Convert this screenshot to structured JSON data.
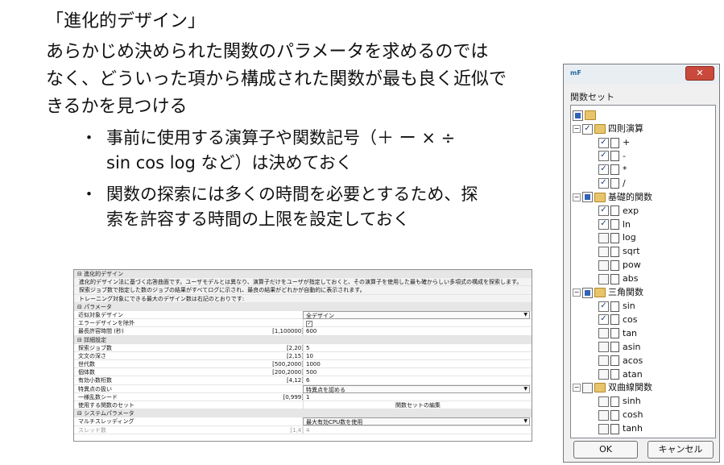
{
  "slide": {
    "title": "「進化的デザイン」",
    "paragraph": [
      "あらかじめ決められた関数のパラメータを求めるのでは",
      "なく、どういった項から構成された関数が最も良く近似で",
      "きるかを見つける"
    ],
    "bullets": [
      {
        "dot": "・",
        "lines": [
          "事前に使用する演算子や関数記号（＋ ー × ÷",
          "sin cos log など）は決めておく"
        ]
      },
      {
        "dot": "・",
        "lines": [
          "関数の探索には多くの時間を必要とするため、探",
          "索を許容する時間の上限を設定しておく"
        ]
      }
    ]
  },
  "panel": {
    "sec1": "⊟ 進化的デザイン",
    "desc": [
      "進化的デザイン法に基づく応答曲面です。ユーザモデルとは異なり、演算子だけをユーザが指定しておくと、その演算子を使用した最も確からしい多項式の構成を探索します。",
      "探索ジョブ数で指定した数のジョブの結果がすべてログに示され、最良の結果がどれかが自動的に表示されます。",
      "トレーニング対象にできる最大のデザイン数は右記のとおりです:"
    ],
    "sec2": "⊟ パラメータ",
    "params": [
      {
        "label": "近似対象デザイン",
        "range": "",
        "value": "全デザイン",
        "type": "dropdown"
      },
      {
        "label": "エラーデザインを除外",
        "range": "",
        "value": "✓",
        "type": "check"
      },
      {
        "label": "最長許容時間 (秒)",
        "range": "[1,100000]",
        "value": "600",
        "type": "text"
      }
    ],
    "sec3": "⊟ 詳細設定",
    "adv": [
      {
        "label": "探索ジョブ数",
        "range": "[2,20]",
        "value": "5",
        "type": "text"
      },
      {
        "label": "文文の深さ",
        "range": "[2,15]",
        "value": "10",
        "type": "text"
      },
      {
        "label": "世代数",
        "range": "[500,2000]",
        "value": "1000",
        "type": "text"
      },
      {
        "label": "個体数",
        "range": "[200,2000]",
        "value": "500",
        "type": "text"
      },
      {
        "label": "有効小数桁数",
        "range": "[4,12]",
        "value": "6",
        "type": "text"
      },
      {
        "label": "特異点の扱い",
        "range": "",
        "value": "特異点を認める",
        "type": "dropdown"
      },
      {
        "label": "一様乱数シード",
        "range": "[0,999]",
        "value": "1",
        "type": "text"
      },
      {
        "label": "使用する関数のセット",
        "range": "",
        "value": "関数セットの編集",
        "type": "button"
      }
    ],
    "sec4": "⊟ システムパラメータ",
    "sys": [
      {
        "label": "マルチスレッディング",
        "range": "",
        "value": "最大有効CPU数を使用",
        "type": "dropdown"
      },
      {
        "label": "スレッド数",
        "range": "[1,4]",
        "value": "4",
        "type": "text",
        "disabled": true
      }
    ]
  },
  "dialog": {
    "app_icon": "mF",
    "close": "✕",
    "label": "関数セット",
    "root_check": "ind",
    "groups": [
      {
        "name": "四則演算",
        "check": "on",
        "items": [
          {
            "name": "+",
            "check": "on"
          },
          {
            "name": "-",
            "check": "on"
          },
          {
            "name": "*",
            "check": "on"
          },
          {
            "name": "/",
            "check": "on"
          }
        ]
      },
      {
        "name": "基礎的関数",
        "check": "ind",
        "items": [
          {
            "name": "exp",
            "check": "on"
          },
          {
            "name": "ln",
            "check": "on"
          },
          {
            "name": "log",
            "check": "off"
          },
          {
            "name": "sqrt",
            "check": "off"
          },
          {
            "name": "pow",
            "check": "off"
          },
          {
            "name": "abs",
            "check": "off"
          }
        ]
      },
      {
        "name": "三角関数",
        "check": "ind",
        "items": [
          {
            "name": "sin",
            "check": "on"
          },
          {
            "name": "cos",
            "check": "on"
          },
          {
            "name": "tan",
            "check": "off"
          },
          {
            "name": "asin",
            "check": "off"
          },
          {
            "name": "acos",
            "check": "off"
          },
          {
            "name": "atan",
            "check": "off"
          }
        ]
      },
      {
        "name": "双曲線関数",
        "check": "off",
        "items": [
          {
            "name": "sinh",
            "check": "off"
          },
          {
            "name": "cosh",
            "check": "off"
          },
          {
            "name": "tanh",
            "check": "off"
          }
        ]
      }
    ],
    "ok": "OK",
    "cancel": "キャンセル"
  }
}
